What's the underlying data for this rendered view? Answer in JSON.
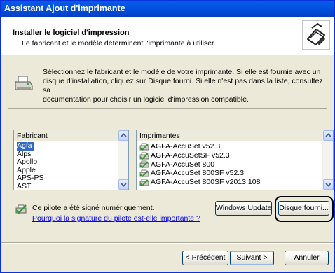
{
  "window": {
    "title": "Assistant Ajout d'imprimante"
  },
  "header": {
    "title": "Installer le logiciel d'impression",
    "subtitle": "Le fabricant et le modèle déterminent l'imprimante à utiliser.",
    "icon": "printer-icon"
  },
  "intro": {
    "icon": "printer-icon",
    "lines": [
      "Sélectionnez le fabricant et le modèle de votre imprimante. Si elle est fournie avec un",
      "disque d'installation, cliquez sur Disque fourni. Si elle n'est pas dans la liste, consultez sa",
      "documentation pour choisir un logiciel d'impression compatible."
    ]
  },
  "manufacturers": {
    "header": "Fabricant",
    "items": [
      "Agfa",
      "Alps",
      "Apollo",
      "Apple",
      "APS-PS",
      "AST"
    ],
    "selected": "Agfa"
  },
  "printers": {
    "header": "Imprimantes",
    "items": [
      "AGFA-AccuSet v52.3",
      "AGFA-AccuSetSF v52.3",
      "AGFA-AccuSet 800",
      "AGFA-AccuSet 800SF v52.3",
      "AGFA-AccuSet 800SF v2013.108"
    ],
    "item_icon": "printer-driver-icon"
  },
  "signature": {
    "icon": "signed-driver-icon",
    "text": "Ce pilote a été signé numériquement.",
    "link": "Pourquoi la signature du pilote est-elle importante ?"
  },
  "buttons": {
    "windows_update": "Windows Update",
    "have_disk": "Disque fourni...",
    "back": "< Précédent",
    "next": "Suivant >",
    "cancel": "Annuler"
  }
}
